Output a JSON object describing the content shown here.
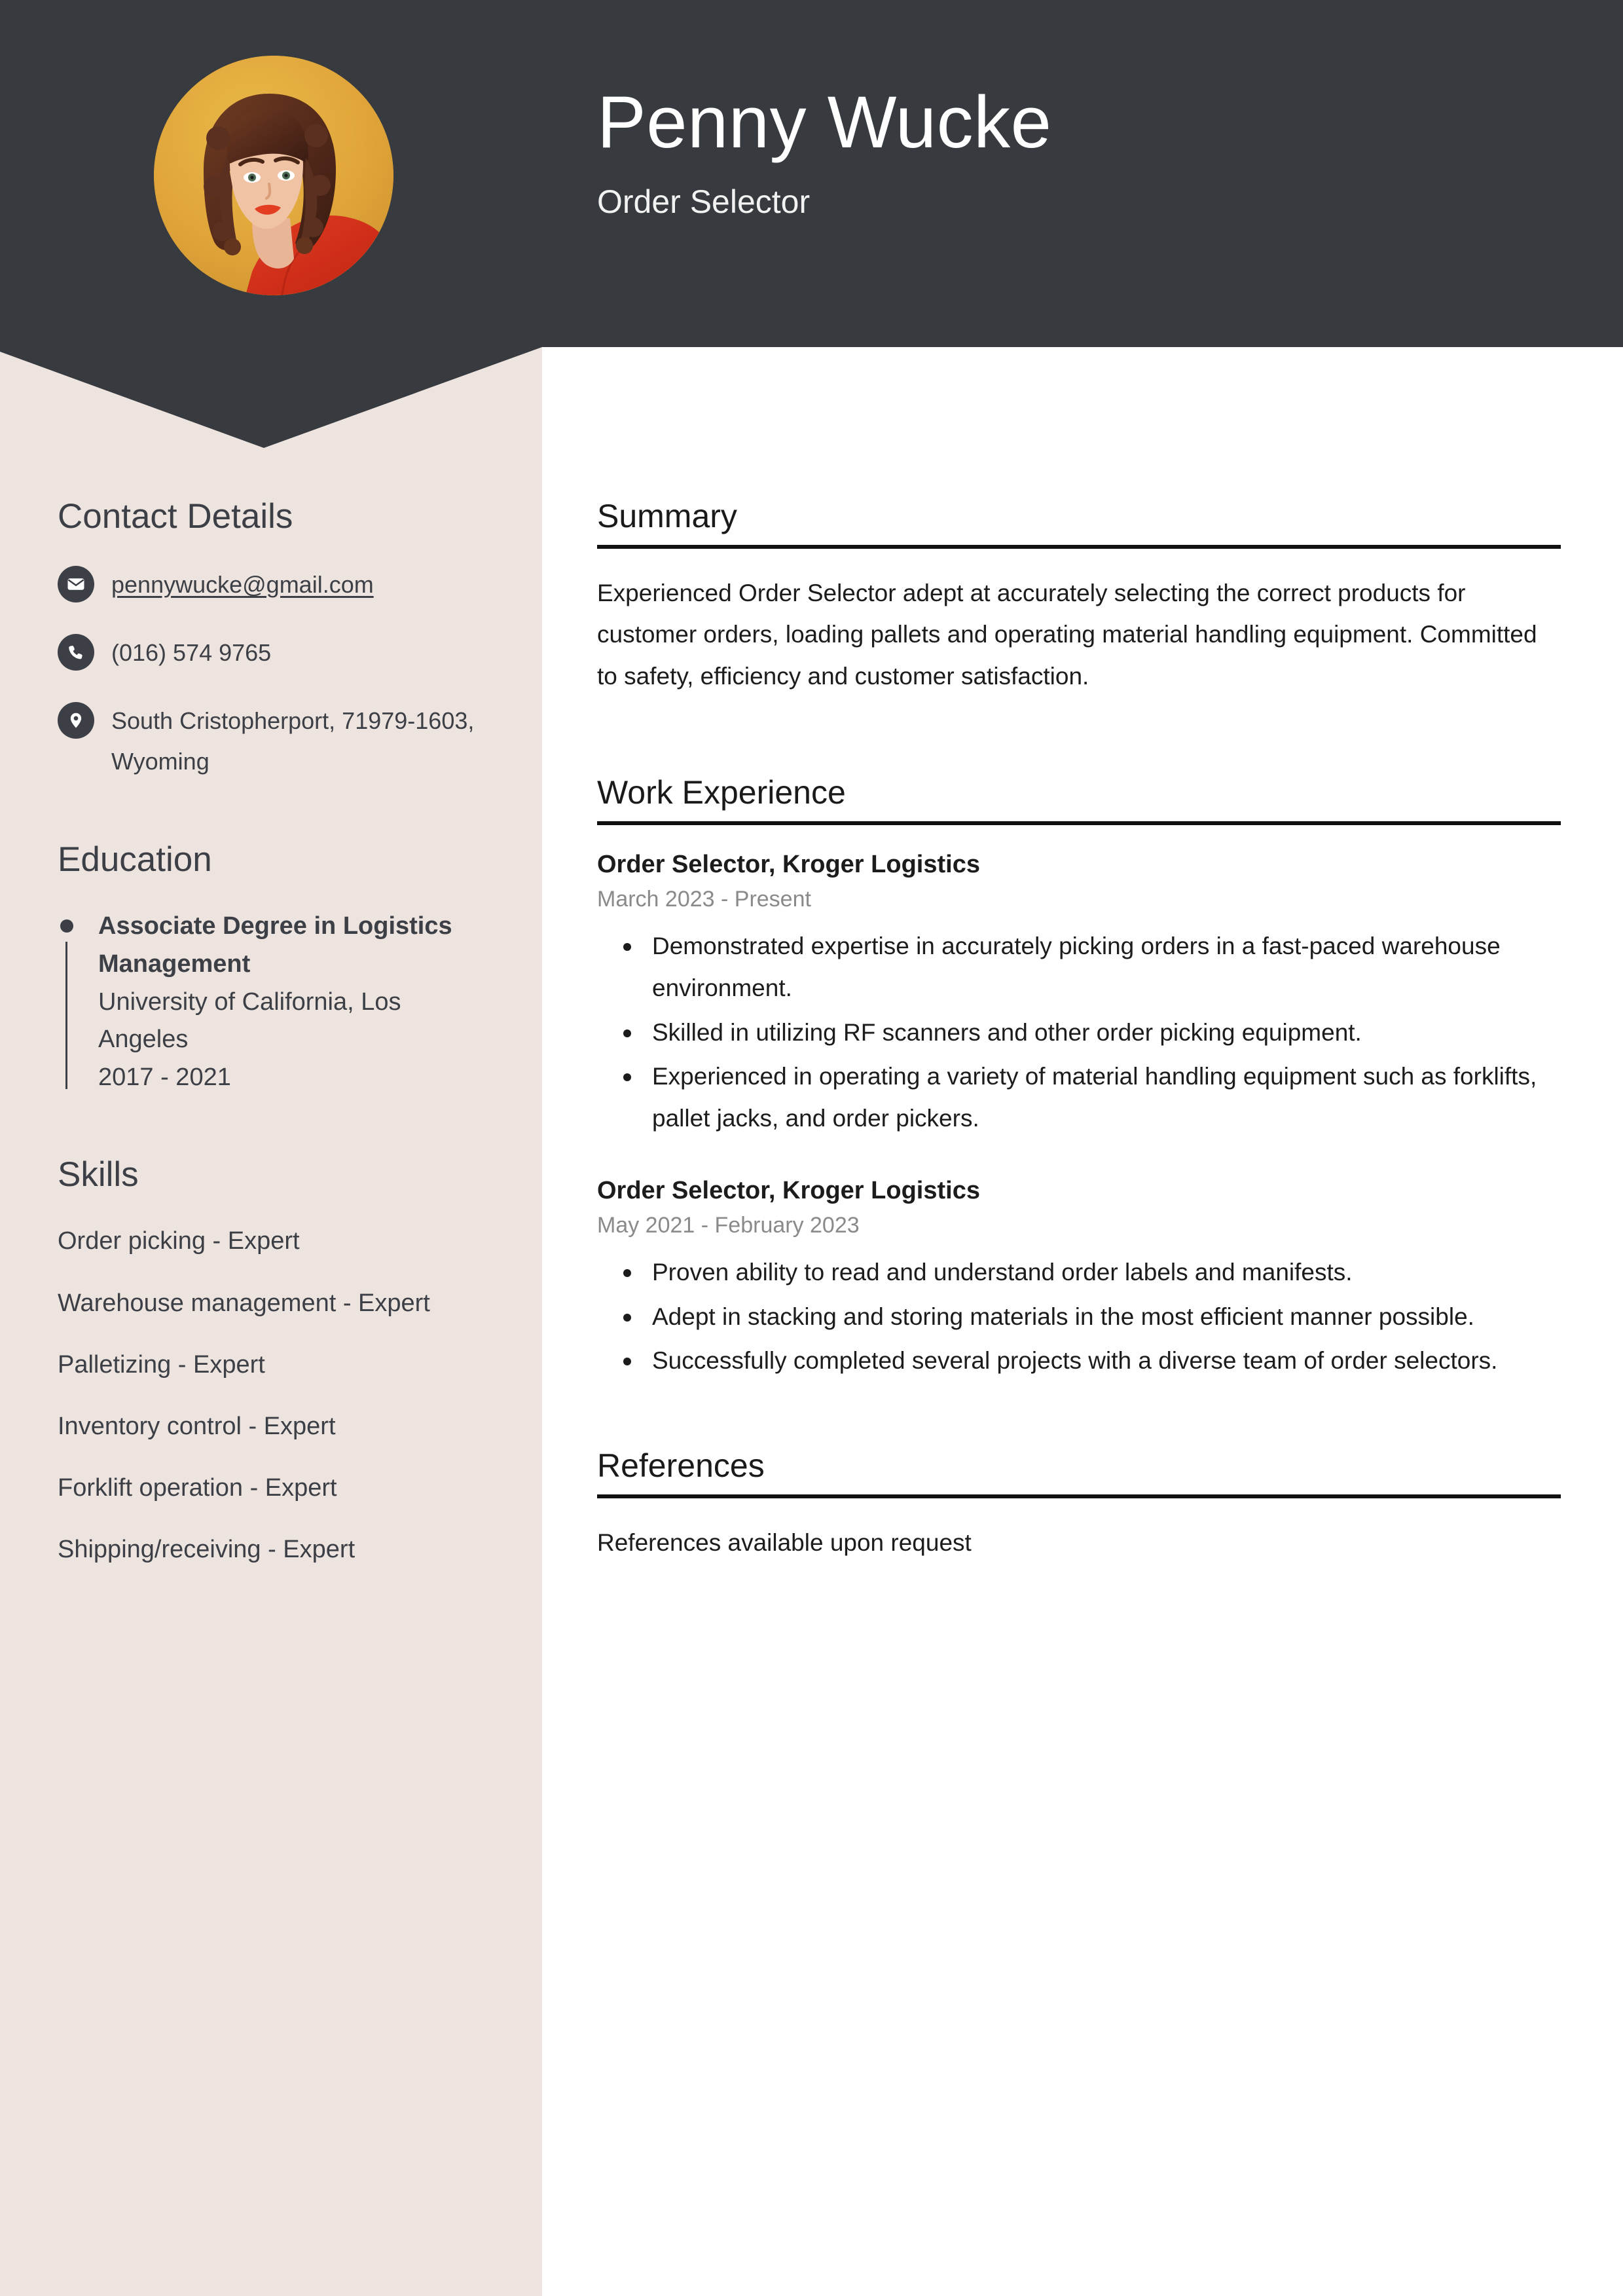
{
  "theme": {
    "header_bg": "#373a3f",
    "sidebar_bg": "#ede4df",
    "page_bg": "#ffffff",
    "text_dark": "#3c3f45",
    "text_muted": "#8a8a8a",
    "rule_color": "#111111",
    "photo_bg": "#e0a53a"
  },
  "header": {
    "name": "Penny Wucke",
    "job_title": "Order Selector"
  },
  "sidebar": {
    "contact": {
      "heading": "Contact Details",
      "items": [
        {
          "icon": "envelope-icon",
          "value": "pennywucke@gmail.com",
          "is_link": true
        },
        {
          "icon": "phone-icon",
          "value": "(016) 574 9765",
          "is_link": false
        },
        {
          "icon": "location-pin-icon",
          "value": "South Cristopherport, 71979-1603, Wyoming",
          "is_link": false
        }
      ]
    },
    "education": {
      "heading": "Education",
      "entries": [
        {
          "degree": "Associate Degree in Logistics Management",
          "school": "University of California, Los Angeles",
          "years": "2017 - 2021"
        }
      ]
    },
    "skills": {
      "heading": "Skills",
      "items": [
        "Order picking - Expert",
        "Warehouse management - Expert",
        "Palletizing - Expert",
        "Inventory control - Expert",
        "Forklift operation - Expert",
        "Shipping/receiving - Expert"
      ]
    }
  },
  "main": {
    "summary": {
      "heading": "Summary",
      "text": "Experienced Order Selector adept at accurately selecting the correct products for customer orders, loading pallets and operating material handling equipment. Committed to safety, efficiency and customer satisfaction."
    },
    "work_experience": {
      "heading": "Work Experience",
      "jobs": [
        {
          "role": "Order Selector, Kroger Logistics",
          "dates": "March 2023 - Present",
          "bullets": [
            "Demonstrated expertise in accurately picking orders in a fast-paced warehouse environment.",
            "Skilled in utilizing RF scanners and other order picking equipment.",
            "Experienced in operating a variety of material handling equipment such as forklifts, pallet jacks, and order pickers."
          ]
        },
        {
          "role": "Order Selector, Kroger Logistics",
          "dates": "May 2021 - February 2023",
          "bullets": [
            "Proven ability to read and understand order labels and manifests.",
            "Adept in stacking and storing materials in the most efficient manner possible.",
            "Successfully completed several projects with a diverse team of order selectors."
          ]
        }
      ]
    },
    "references": {
      "heading": "References",
      "text": "References available upon request"
    }
  }
}
